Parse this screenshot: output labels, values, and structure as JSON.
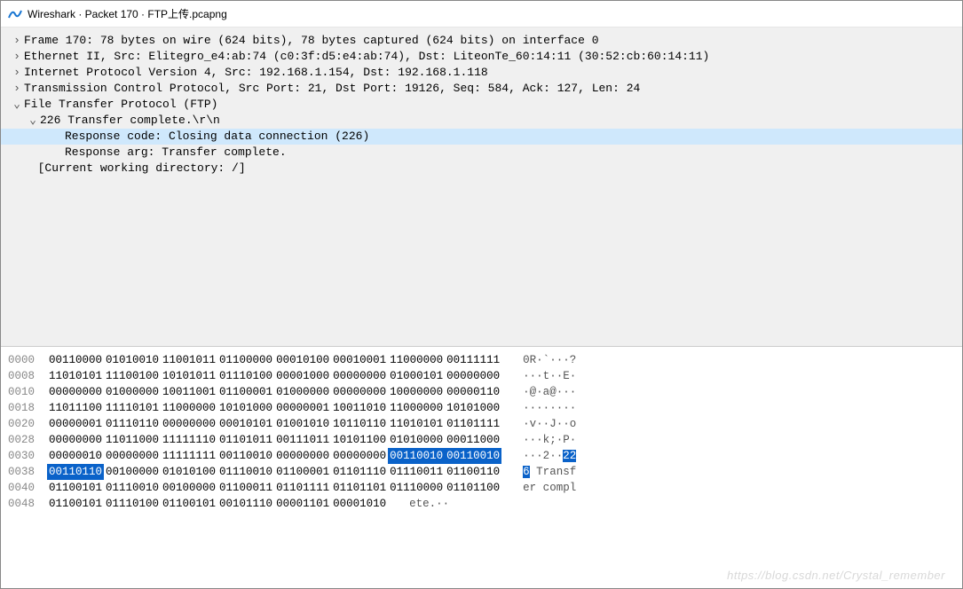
{
  "title": "Wireshark · Packet 170 · FTP上传.pcapng",
  "tree": [
    {
      "indent": 0,
      "caret": ">",
      "text": "Frame 170: 78 bytes on wire (624 bits), 78 bytes captured (624 bits) on interface 0",
      "highlight": false
    },
    {
      "indent": 0,
      "caret": ">",
      "text": "Ethernet II, Src: Elitegro_e4:ab:74 (c0:3f:d5:e4:ab:74), Dst: LiteonTe_60:14:11 (30:52:cb:60:14:11)",
      "highlight": false
    },
    {
      "indent": 0,
      "caret": ">",
      "text": "Internet Protocol Version 4, Src: 192.168.1.154, Dst: 192.168.1.118",
      "highlight": false
    },
    {
      "indent": 0,
      "caret": ">",
      "text": "Transmission Control Protocol, Src Port: 21, Dst Port: 19126, Seq: 584, Ack: 127, Len: 24",
      "highlight": false
    },
    {
      "indent": 0,
      "caret": "v",
      "text": "File Transfer Protocol (FTP)",
      "highlight": false
    },
    {
      "indent": 1,
      "caret": "v",
      "text": "226 Transfer complete.\\r\\n",
      "highlight": false
    },
    {
      "indent": 2,
      "caret": "",
      "text": "Response code: Closing data connection (226)",
      "highlight": true
    },
    {
      "indent": 2,
      "caret": "",
      "text": "Response arg: Transfer complete.",
      "highlight": false
    },
    {
      "indent": 0,
      "caret": "",
      "text": "  [Current working directory: /]",
      "highlight": false
    }
  ],
  "hex": [
    {
      "offset": "0000",
      "bytes": [
        "00110000",
        "01010010",
        "11001011",
        "01100000",
        "00010100",
        "00010001",
        "11000000",
        "00111111"
      ],
      "ascii": "0R·`···?",
      "sel": [],
      "ascSel": []
    },
    {
      "offset": "0008",
      "bytes": [
        "11010101",
        "11100100",
        "10101011",
        "01110100",
        "00001000",
        "00000000",
        "01000101",
        "00000000"
      ],
      "ascii": "···t··E·",
      "sel": [],
      "ascSel": []
    },
    {
      "offset": "0010",
      "bytes": [
        "00000000",
        "01000000",
        "10011001",
        "01100001",
        "01000000",
        "00000000",
        "10000000",
        "00000110"
      ],
      "ascii": "·@·a@···",
      "sel": [],
      "ascSel": []
    },
    {
      "offset": "0018",
      "bytes": [
        "11011100",
        "11110101",
        "11000000",
        "10101000",
        "00000001",
        "10011010",
        "11000000",
        "10101000"
      ],
      "ascii": "········",
      "sel": [],
      "ascSel": []
    },
    {
      "offset": "0020",
      "bytes": [
        "00000001",
        "01110110",
        "00000000",
        "00010101",
        "01001010",
        "10110110",
        "11010101",
        "01101111"
      ],
      "ascii": "·v··J··o",
      "sel": [],
      "ascSel": []
    },
    {
      "offset": "0028",
      "bytes": [
        "00000000",
        "11011000",
        "11111110",
        "01101011",
        "00111011",
        "10101100",
        "01010000",
        "00011000"
      ],
      "ascii": "···k;·P·",
      "sel": [],
      "ascSel": []
    },
    {
      "offset": "0030",
      "bytes": [
        "00000010",
        "00000000",
        "11111111",
        "00110010",
        "00000000",
        "00000000",
        "00110010",
        "00110010"
      ],
      "ascii": "···2··22",
      "sel": [
        6,
        7
      ],
      "ascSel": [
        6,
        7
      ]
    },
    {
      "offset": "0038",
      "bytes": [
        "00110110",
        "00100000",
        "01010100",
        "01110010",
        "01100001",
        "01101110",
        "01110011",
        "01100110"
      ],
      "ascii": "6 Transf",
      "sel": [
        0
      ],
      "ascSel": [
        0
      ]
    },
    {
      "offset": "0040",
      "bytes": [
        "01100101",
        "01110010",
        "00100000",
        "01100011",
        "01101111",
        "01101101",
        "01110000",
        "01101100"
      ],
      "ascii": "er compl",
      "sel": [],
      "ascSel": []
    },
    {
      "offset": "0048",
      "bytes": [
        "01100101",
        "01110100",
        "01100101",
        "00101110",
        "00001101",
        "00001010"
      ],
      "ascii": "ete.··",
      "sel": [],
      "ascSel": []
    }
  ],
  "watermark": "https://blog.csdn.net/Crystal_remember"
}
